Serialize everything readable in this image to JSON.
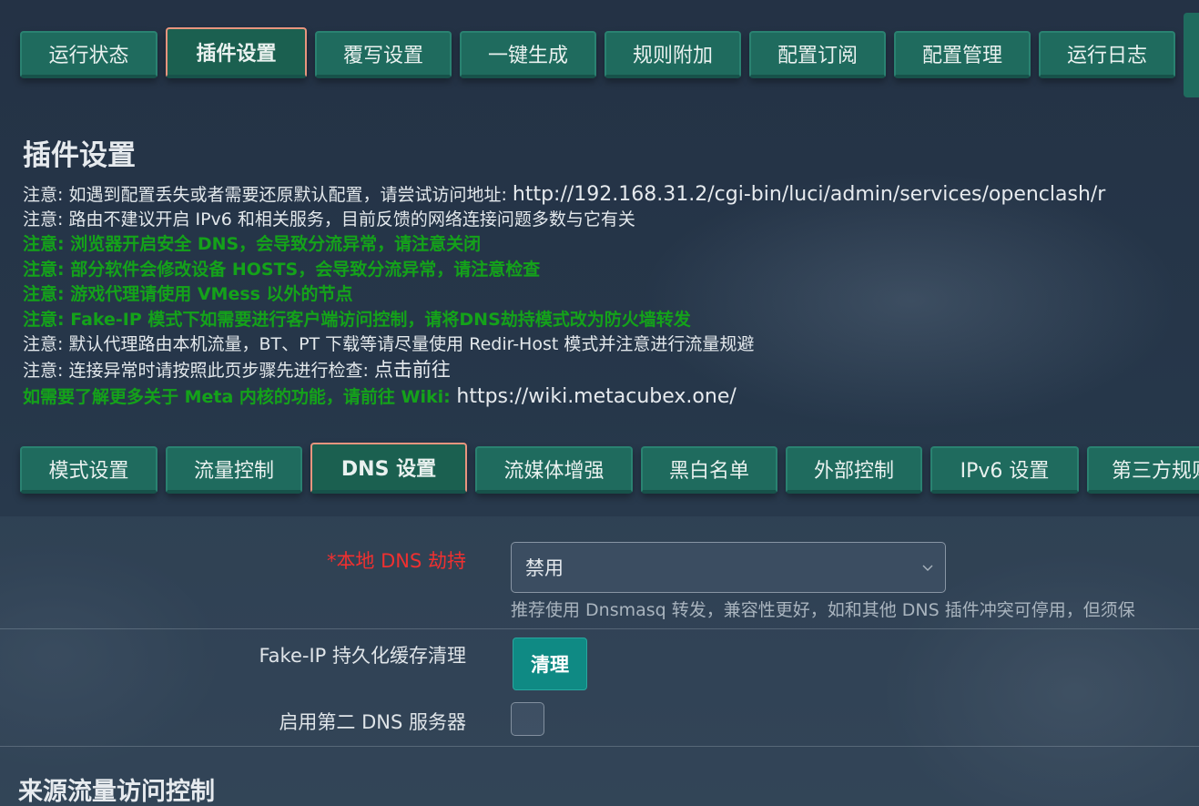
{
  "top_tabs": [
    {
      "label": "运行状态",
      "active": false
    },
    {
      "label": "插件设置",
      "active": true
    },
    {
      "label": "覆写设置",
      "active": false
    },
    {
      "label": "一键生成",
      "active": false
    },
    {
      "label": "规则附加",
      "active": false
    },
    {
      "label": "配置订阅",
      "active": false
    },
    {
      "label": "配置管理",
      "active": false
    },
    {
      "label": "运行日志",
      "active": false
    }
  ],
  "page": {
    "title": "插件设置"
  },
  "notices": [
    {
      "prefix": "注意: 如遇到配置丢失或者需要还原默认配置，请尝试访问地址: ",
      "link": "http://192.168.31.2/cgi-bin/luci/admin/services/openclash/r",
      "color": "white"
    },
    {
      "prefix": "注意: 路由不建议开启 IPv6 和相关服务，目前反馈的网络连接问题多数与它有关",
      "link": "",
      "color": "white"
    },
    {
      "prefix": "注意: 浏览器开启安全 DNS，会导致分流异常，请注意关闭",
      "link": "",
      "color": "green"
    },
    {
      "prefix": "注意: 部分软件会修改设备 HOSTS，会导致分流异常，请注意检查",
      "link": "",
      "color": "green"
    },
    {
      "prefix": "注意: 游戏代理请使用 VMess 以外的节点",
      "link": "",
      "color": "green"
    },
    {
      "prefix": "注意: Fake-IP 模式下如需要进行客户端访问控制，请将DNS劫持模式改为防火墙转发",
      "link": "",
      "color": "green"
    },
    {
      "prefix": "注意: 默认代理路由本机流量，BT、PT 下载等请尽量使用 Redir-Host 模式并注意进行流量规避",
      "link": "",
      "color": "white"
    },
    {
      "prefix": "注意: 连接异常时请按照此页步骤先进行检查: ",
      "link": "点击前往",
      "color": "white"
    },
    {
      "prefix": "如需要了解更多关于 Meta 内核的功能，请前往 Wiki: ",
      "link": "https://wiki.metacubex.one/",
      "color": "green"
    }
  ],
  "sub_tabs": [
    {
      "label": "模式设置",
      "active": false
    },
    {
      "label": "流量控制",
      "active": false
    },
    {
      "label": "DNS 设置",
      "active": true
    },
    {
      "label": "流媒体增强",
      "active": false
    },
    {
      "label": "黑白名单",
      "active": false
    },
    {
      "label": "外部控制",
      "active": false
    },
    {
      "label": "IPv6 设置",
      "active": false
    },
    {
      "label": "第三方规则",
      "active": false
    }
  ],
  "dns_form": {
    "hijack_label": "*本地 DNS 劫持",
    "hijack_value": "禁用",
    "hijack_hint": "推荐使用 Dnsmasq 转发，兼容性更好，如和其他 DNS 插件冲突可停用，但须保",
    "fakeip_label": "Fake-IP 持久化缓存清理",
    "fakeip_button": "清理",
    "second_dns_label": "启用第二 DNS 服务器"
  },
  "next_section": {
    "title": "来源流量访问控制"
  },
  "colors": {
    "tab_bg": "#1f6b5e",
    "active_tab_border": "#e8957e",
    "notice_green": "#14a21a",
    "required_red": "#f03030",
    "button_teal": "#0f8a84"
  }
}
